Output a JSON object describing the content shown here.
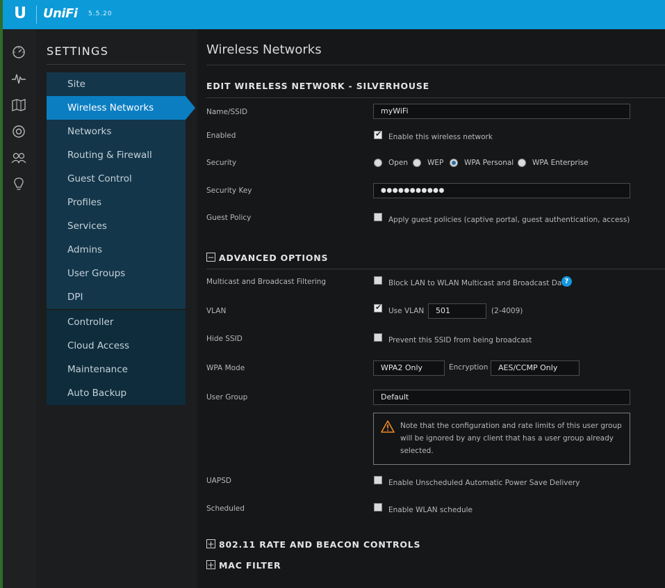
{
  "app": {
    "logo": "U",
    "name": "UniFi",
    "version": "5.5.20"
  },
  "rail": {
    "items": [
      {
        "icon": "dashboard-icon"
      },
      {
        "icon": "statistics-icon"
      },
      {
        "icon": "map-icon"
      },
      {
        "icon": "devices-icon"
      },
      {
        "icon": "clients-icon"
      },
      {
        "icon": "insights-icon"
      }
    ]
  },
  "sidebar": {
    "title": "SETTINGS",
    "items": [
      {
        "label": "Site"
      },
      {
        "label": "Wireless Networks",
        "active": true
      },
      {
        "label": "Networks"
      },
      {
        "label": "Routing & Firewall"
      },
      {
        "label": "Guest Control"
      },
      {
        "label": "Profiles"
      },
      {
        "label": "Services"
      },
      {
        "label": "Admins"
      },
      {
        "label": "User Groups"
      },
      {
        "label": "DPI"
      },
      {
        "label": "Controller"
      },
      {
        "label": "Cloud Access"
      },
      {
        "label": "Maintenance"
      },
      {
        "label": "Auto Backup"
      }
    ]
  },
  "main": {
    "title": "Wireless Networks",
    "edit_heading": "EDIT WIRELESS NETWORK - SILVERHOUSE",
    "fields": {
      "ssid_label": "Name/SSID",
      "ssid_value": "myWiFi",
      "enabled_label": "Enabled",
      "enabled_text": "Enable this wireless network",
      "enabled_checked": true,
      "security_label": "Security",
      "security_options": [
        "Open",
        "WEP",
        "WPA Personal",
        "WPA Enterprise"
      ],
      "security_selected": "WPA Personal",
      "key_label": "Security Key",
      "key_value": "●●●●●●●●●●●",
      "guest_label": "Guest Policy",
      "guest_text": "Apply guest policies (captive portal, guest authentication, access)",
      "guest_checked": false
    },
    "advanced": {
      "heading": "ADVANCED OPTIONS",
      "toggle": "−",
      "multicast_label": "Multicast and Broadcast Filtering",
      "multicast_text": "Block LAN to WLAN Multicast and Broadcast Data",
      "help": "?",
      "vlan_label": "VLAN",
      "vlan_text": "Use VLAN",
      "vlan_value": "501",
      "vlan_range": "(2-4009)",
      "hide_label": "Hide SSID",
      "hide_text": "Prevent this SSID from being broadcast",
      "wpa_label": "WPA Mode",
      "wpa_value": "WPA2 Only",
      "encryption_label": "Encryption",
      "encryption_value": "AES/CCMP Only",
      "usergroup_label": "User Group",
      "usergroup_value": "Default",
      "warning": "Note that the configuration and rate limits of this user group will be ignored by any client that has a user group already selected.",
      "uapsd_label": "UAPSD",
      "uapsd_text": "Enable Unscheduled Automatic Power Save Delivery",
      "scheduled_label": "Scheduled",
      "scheduled_text": "Enable WLAN schedule"
    },
    "rate_heading": "802.11 RATE AND BEACON CONTROLS",
    "mac_heading": "MAC FILTER",
    "expand_toggle": "+"
  },
  "colors": {
    "topbar": "#0c9ad8",
    "active": "#0b7ec2",
    "warning": "#f08a24"
  }
}
